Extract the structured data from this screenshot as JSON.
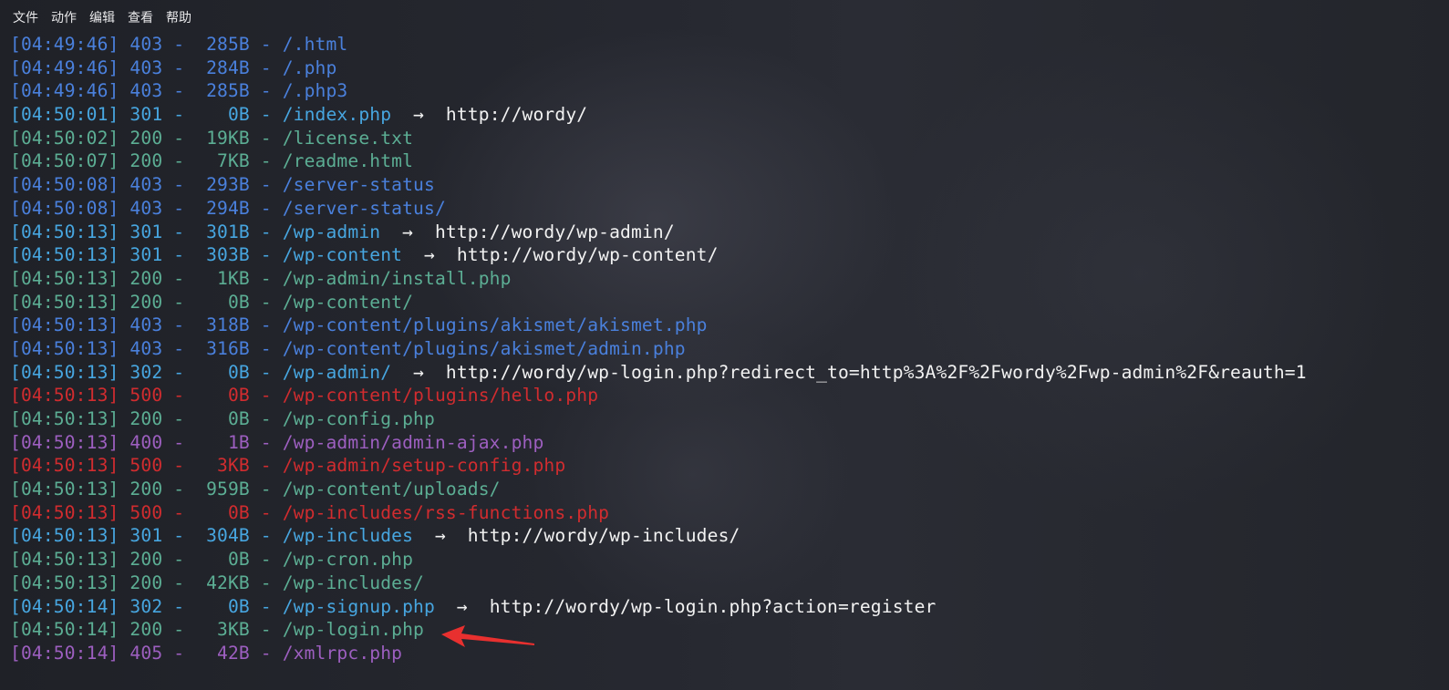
{
  "menu": [
    "文件",
    "动作",
    "编辑",
    "查看",
    "帮助"
  ],
  "colors": {
    "blue": "#4a80dc",
    "green": "#5cae94",
    "light_blue": "#47a6e0",
    "red": "#d12c2f",
    "purple": "#9d5fc0",
    "redirect_text": "#f2f2f2",
    "annotation_arrow": "#e8302f"
  },
  "lines": [
    {
      "time": "[04:49:46]",
      "status": "403",
      "size": "285B",
      "path": "/.html",
      "redirect": "",
      "color": "blue"
    },
    {
      "time": "[04:49:46]",
      "status": "403",
      "size": "284B",
      "path": "/.php",
      "redirect": "",
      "color": "blue"
    },
    {
      "time": "[04:49:46]",
      "status": "403",
      "size": "285B",
      "path": "/.php3",
      "redirect": "",
      "color": "blue"
    },
    {
      "time": "[04:50:01]",
      "status": "301",
      "size": "0B",
      "path": "/index.php",
      "redirect": "http://wordy/",
      "color": "light_blue"
    },
    {
      "time": "[04:50:02]",
      "status": "200",
      "size": "19KB",
      "path": "/license.txt",
      "redirect": "",
      "color": "green"
    },
    {
      "time": "[04:50:07]",
      "status": "200",
      "size": "7KB",
      "path": "/readme.html",
      "redirect": "",
      "color": "green"
    },
    {
      "time": "[04:50:08]",
      "status": "403",
      "size": "293B",
      "path": "/server-status",
      "redirect": "",
      "color": "blue"
    },
    {
      "time": "[04:50:08]",
      "status": "403",
      "size": "294B",
      "path": "/server-status/",
      "redirect": "",
      "color": "blue"
    },
    {
      "time": "[04:50:13]",
      "status": "301",
      "size": "301B",
      "path": "/wp-admin",
      "redirect": "http://wordy/wp-admin/",
      "color": "light_blue"
    },
    {
      "time": "[04:50:13]",
      "status": "301",
      "size": "303B",
      "path": "/wp-content",
      "redirect": "http://wordy/wp-content/",
      "color": "light_blue"
    },
    {
      "time": "[04:50:13]",
      "status": "200",
      "size": "1KB",
      "path": "/wp-admin/install.php",
      "redirect": "",
      "color": "green"
    },
    {
      "time": "[04:50:13]",
      "status": "200",
      "size": "0B",
      "path": "/wp-content/",
      "redirect": "",
      "color": "green"
    },
    {
      "time": "[04:50:13]",
      "status": "403",
      "size": "318B",
      "path": "/wp-content/plugins/akismet/akismet.php",
      "redirect": "",
      "color": "blue"
    },
    {
      "time": "[04:50:13]",
      "status": "403",
      "size": "316B",
      "path": "/wp-content/plugins/akismet/admin.php",
      "redirect": "",
      "color": "blue"
    },
    {
      "time": "[04:50:13]",
      "status": "302",
      "size": "0B",
      "path": "/wp-admin/",
      "redirect": "http://wordy/wp-login.php?redirect_to=http%3A%2F%2Fwordy%2Fwp-admin%2F&reauth=1",
      "color": "light_blue"
    },
    {
      "time": "[04:50:13]",
      "status": "500",
      "size": "0B",
      "path": "/wp-content/plugins/hello.php",
      "redirect": "",
      "color": "red"
    },
    {
      "time": "[04:50:13]",
      "status": "200",
      "size": "0B",
      "path": "/wp-config.php",
      "redirect": "",
      "color": "green"
    },
    {
      "time": "[04:50:13]",
      "status": "400",
      "size": "1B",
      "path": "/wp-admin/admin-ajax.php",
      "redirect": "",
      "color": "purple"
    },
    {
      "time": "[04:50:13]",
      "status": "500",
      "size": "3KB",
      "path": "/wp-admin/setup-config.php",
      "redirect": "",
      "color": "red"
    },
    {
      "time": "[04:50:13]",
      "status": "200",
      "size": "959B",
      "path": "/wp-content/uploads/",
      "redirect": "",
      "color": "green"
    },
    {
      "time": "[04:50:13]",
      "status": "500",
      "size": "0B",
      "path": "/wp-includes/rss-functions.php",
      "redirect": "",
      "color": "red"
    },
    {
      "time": "[04:50:13]",
      "status": "301",
      "size": "304B",
      "path": "/wp-includes",
      "redirect": "http://wordy/wp-includes/",
      "color": "light_blue"
    },
    {
      "time": "[04:50:13]",
      "status": "200",
      "size": "0B",
      "path": "/wp-cron.php",
      "redirect": "",
      "color": "green"
    },
    {
      "time": "[04:50:13]",
      "status": "200",
      "size": "42KB",
      "path": "/wp-includes/",
      "redirect": "",
      "color": "green"
    },
    {
      "time": "[04:50:14]",
      "status": "302",
      "size": "0B",
      "path": "/wp-signup.php",
      "redirect": "http://wordy/wp-login.php?action=register",
      "color": "light_blue"
    },
    {
      "time": "[04:50:14]",
      "status": "200",
      "size": "3KB",
      "path": "/wp-login.php",
      "redirect": "",
      "color": "green"
    },
    {
      "time": "[04:50:14]",
      "status": "405",
      "size": "42B",
      "path": "/xmlrpc.php",
      "redirect": "",
      "color": "purple"
    }
  ],
  "annotation": {
    "icon": "red-arrow-icon",
    "points_to_line": 25
  }
}
